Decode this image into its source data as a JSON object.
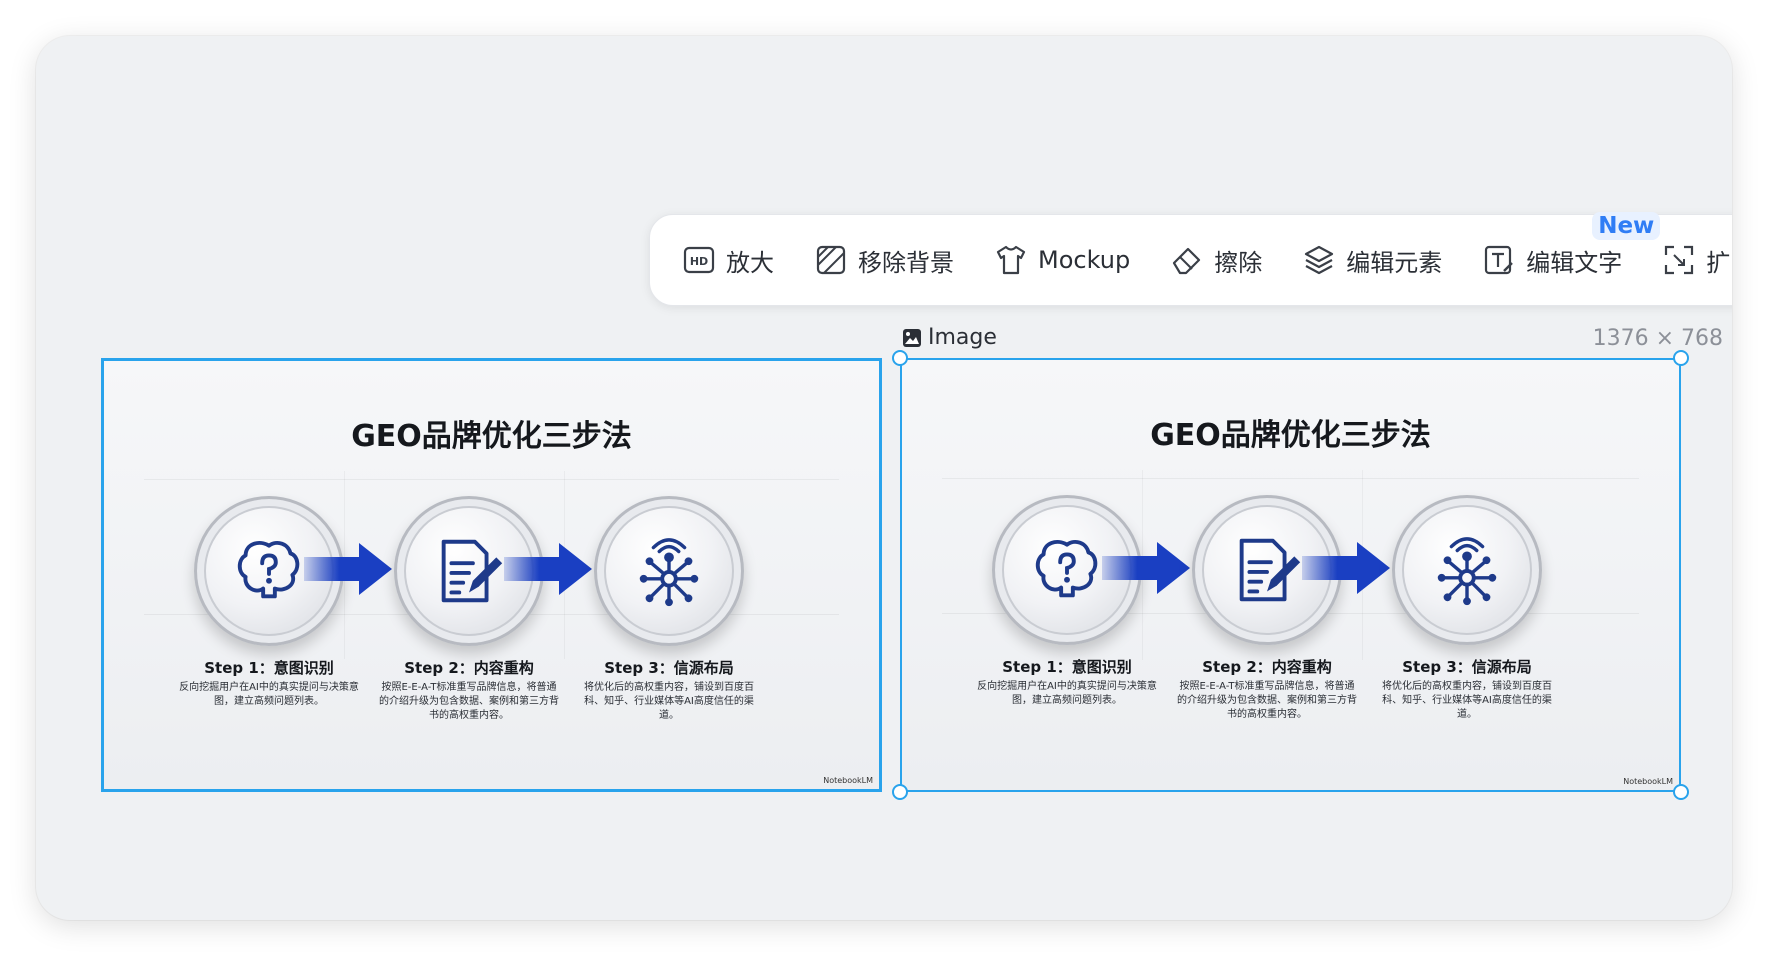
{
  "toolbar": {
    "items": [
      {
        "label": "放大",
        "icon": "hd-icon"
      },
      {
        "label": "移除背景",
        "icon": "remove-background-icon"
      },
      {
        "label": "Mockup",
        "icon": "tshirt-icon"
      },
      {
        "label": "擦除",
        "icon": "eraser-icon"
      },
      {
        "label": "编辑元素",
        "icon": "layers-icon"
      },
      {
        "label": "编辑文字",
        "icon": "edit-text-icon"
      },
      {
        "label": "扩",
        "icon": "expand-icon"
      }
    ],
    "new_badge": "New"
  },
  "image_label": "Image",
  "image_size": "1376 × 768",
  "slide": {
    "title": "GEO品牌优化三步法",
    "steps": [
      {
        "title": "Step 1：意图识别",
        "desc": "反向挖掘用户在AI中的真实提问与决策意图，建立高频问题列表。",
        "icon": "brain-question-icon"
      },
      {
        "title": "Step 2：内容重构",
        "desc": "按照E-E-A-T标准重写品牌信息，将普通的介绍升级为包含数据、案例和第三方背书的高权重内容。",
        "icon": "document-pen-icon"
      },
      {
        "title": "Step 3：信源布局",
        "desc": "将优化后的高权重内容，铺设到百度百科、知乎、行业媒体等AI高度信任的渠道。",
        "icon": "broadcast-network-icon"
      }
    ],
    "brand": "NotebookLM"
  },
  "colors": {
    "accent": "#29a3ec",
    "arrow": "#1a3fc2",
    "icon": "#1e3a8a",
    "badge": "#2f7df5"
  }
}
